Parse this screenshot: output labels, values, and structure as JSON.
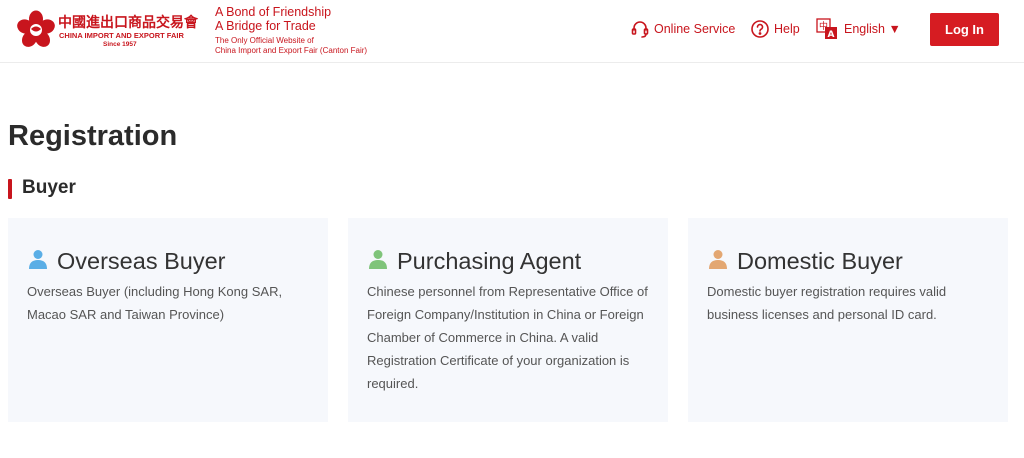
{
  "header": {
    "logo": {
      "cn_text": "中國進出口商品交易會",
      "en_text": "CHINA IMPORT AND EXPORT FAIR",
      "since": "Since 1957"
    },
    "slogan_line1": "A Bond of Friendship",
    "slogan_line2": "A Bridge for Trade",
    "tagline_line1": "The Only Official Website of",
    "tagline_line2": "China Import and Export Fair (Canton Fair)",
    "online_service": {
      "label": "Online Service",
      "icon": "headset-icon"
    },
    "help": {
      "label": "Help",
      "icon": "question-circle-icon"
    },
    "language": {
      "label": "English ▼",
      "icon": "translate-icon"
    },
    "login_label": "Log In"
  },
  "main": {
    "title": "Registration",
    "section_title": "Buyer",
    "cards": [
      {
        "title": "Overseas Buyer",
        "description": "Overseas Buyer (including Hong Kong SAR, Macao SAR and Taiwan Province)",
        "icon": "user-icon",
        "icon_color": "#5aaee6"
      },
      {
        "title": "Purchasing Agent",
        "description": "Chinese personnel from Representative Office of Foreign Company/Institution in China or Foreign Chamber of Commerce in China. A valid Registration Certificate of your organization is required.",
        "icon": "user-icon",
        "icon_color": "#7fc47a"
      },
      {
        "title": "Domestic Buyer",
        "description": "Domestic buyer registration requires valid business licenses and personal ID card.",
        "icon": "user-icon",
        "icon_color": "#e3a772"
      }
    ]
  },
  "colors": {
    "brand_red": "#c8151d",
    "button_red": "#d61c22",
    "card_bg": "#f6f8fc"
  }
}
